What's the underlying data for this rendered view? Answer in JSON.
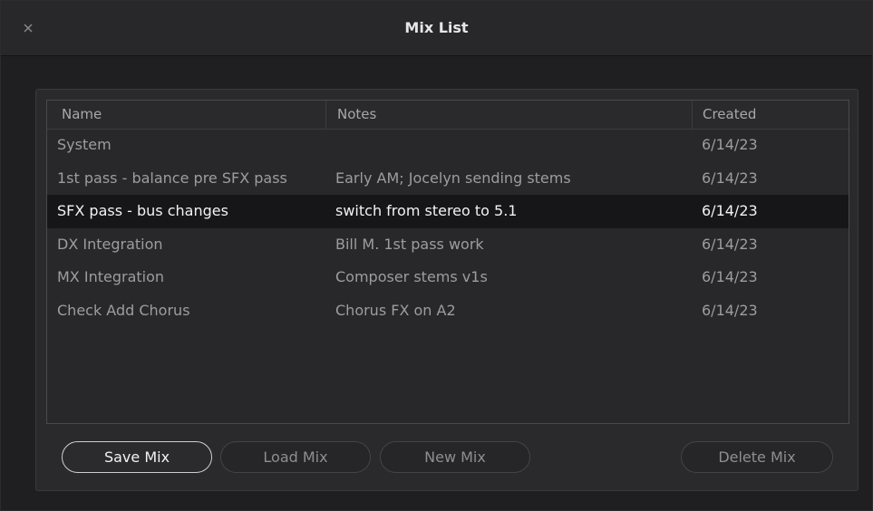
{
  "window": {
    "title": "Mix List"
  },
  "table": {
    "columns": [
      "Name",
      "Notes",
      "Created"
    ],
    "rows": [
      {
        "name": "System",
        "notes": "",
        "created": "6/14/23",
        "selected": false
      },
      {
        "name": "1st pass - balance pre SFX pass",
        "notes": "Early AM; Jocelyn sending stems",
        "created": "6/14/23",
        "selected": false
      },
      {
        "name": "SFX pass - bus changes",
        "notes": "switch from stereo to 5.1",
        "created": "6/14/23",
        "selected": true
      },
      {
        "name": "DX Integration",
        "notes": "Bill M. 1st pass work",
        "created": "6/14/23",
        "selected": false
      },
      {
        "name": "MX Integration",
        "notes": "Composer stems v1s",
        "created": "6/14/23",
        "selected": false
      },
      {
        "name": "Check Add Chorus",
        "notes": "Chorus FX on A2",
        "created": "6/14/23",
        "selected": false
      }
    ]
  },
  "buttons": {
    "save": "Save Mix",
    "load": "Load Mix",
    "new": "New Mix",
    "delete": "Delete Mix"
  },
  "icons": {
    "close": "close-icon"
  },
  "colors": {
    "background": "#1f1f21",
    "selected_row": "#161618",
    "text_dim": "#9d9d9f",
    "text_bright": "#f2f2f2"
  }
}
